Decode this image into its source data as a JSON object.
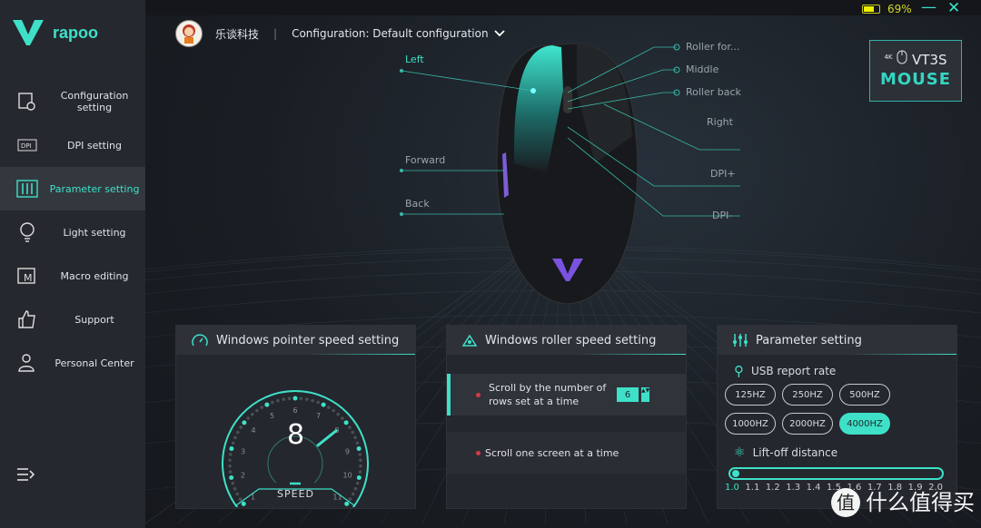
{
  "brand": {
    "logo_text": "rapoo"
  },
  "sidebar": {
    "items": [
      {
        "label": "Configuration setting",
        "icon": "config-icon"
      },
      {
        "label": "DPI setting",
        "icon": "dpi-icon"
      },
      {
        "label": "Parameter setting",
        "icon": "equalizer-icon",
        "active": true
      },
      {
        "label": "Light setting",
        "icon": "bulb-icon"
      },
      {
        "label": "Macro editing",
        "icon": "macro-icon"
      },
      {
        "label": "Support",
        "icon": "thumbs-up-icon"
      },
      {
        "label": "Personal Center",
        "icon": "user-icon"
      }
    ]
  },
  "status": {
    "battery": "69%",
    "battery_level": 0.69
  },
  "header": {
    "username": "乐谈科技",
    "configuration": "Configuration: Default configuration"
  },
  "device": {
    "badge": "4K",
    "name": "VT3S",
    "type": "MOUSE"
  },
  "mouse_labels": {
    "left": "Left",
    "forward": "Forward",
    "back": "Back",
    "roller_forward": "Roller for...",
    "middle": "Middle",
    "roller_back": "Roller back",
    "right": "Right",
    "dpi_plus": "DPI+",
    "dpi_minus": "DPI-"
  },
  "pointer": {
    "title": "Windows pointer speed setting",
    "value": "8",
    "speed_label": "SPEED",
    "ticks": [
      "1",
      "2",
      "3",
      "4",
      "5",
      "6",
      "7",
      "8",
      "9",
      "10",
      "11"
    ]
  },
  "roller": {
    "title": "Windows roller speed setting",
    "option1": "Scroll by the number of rows set at a time",
    "option1_value": "6",
    "option2": "Scroll one screen at a time",
    "selected": "option1"
  },
  "params": {
    "title": "Parameter setting",
    "usb_label": "USB report rate",
    "rates": [
      "125HZ",
      "250HZ",
      "500HZ",
      "1000HZ",
      "2000HZ",
      "4000HZ"
    ],
    "selected_rate": "4000HZ",
    "liftoff_label": "Lift-off distance",
    "liftoff_ticks": [
      "1.0",
      "1.1",
      "1.2",
      "1.3",
      "1.4",
      "1.5",
      "1.6",
      "1.7",
      "1.8",
      "1.9",
      "2.0"
    ],
    "liftoff_value": 1.0
  },
  "watermark": {
    "text": "什么值得买",
    "mark": "值"
  },
  "colors": {
    "accent": "#3ee0c8",
    "battery": "#f0f000"
  }
}
